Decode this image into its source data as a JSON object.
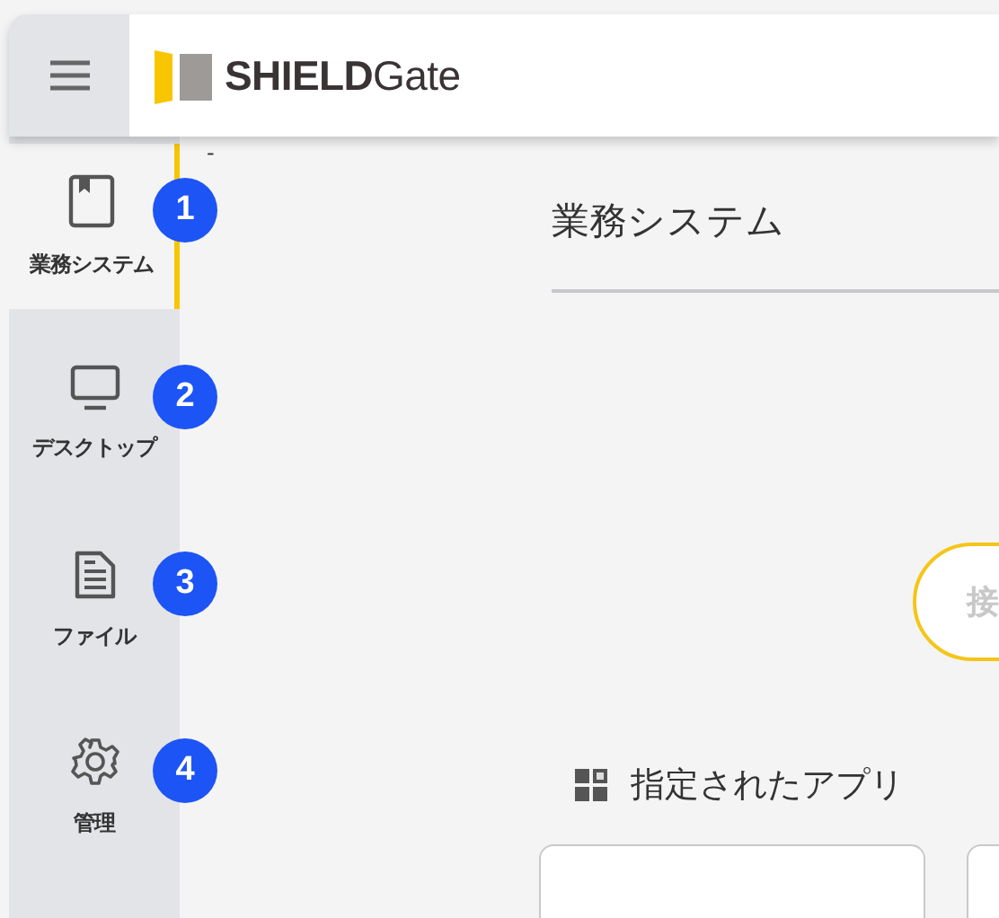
{
  "header": {
    "logo_text": "**SHIELD**Gate"
  },
  "sidebar": {
    "items": [
      {
        "label": "業務システム",
        "selected": true,
        "badge": "1"
      },
      {
        "label": "デスクトップ",
        "selected": false,
        "badge": "2"
      },
      {
        "label": "ファイル",
        "selected": false,
        "badge": "3"
      },
      {
        "label": "管理",
        "selected": false,
        "badge": "4"
      }
    ]
  },
  "main": {
    "marker": "-",
    "title": "業務システム",
    "connect_button": {
      "label": "接"
    },
    "section_title": "指定されたアプリ",
    "cards": [
      {
        "kind": "card"
      },
      {
        "kind": "card"
      }
    ]
  }
}
